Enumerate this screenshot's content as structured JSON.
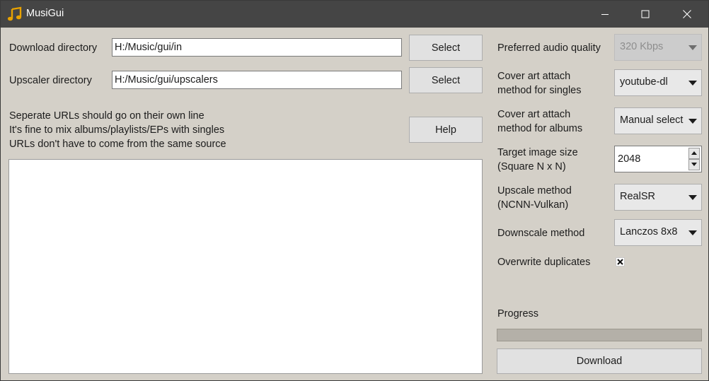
{
  "window": {
    "title": "MusiGui",
    "icon": "music-note-icon",
    "controls": [
      "minimize-icon",
      "maximize-icon",
      "close-icon"
    ]
  },
  "directories": {
    "download_label": "Download directory",
    "download_value": "H:/Music/gui/in",
    "download_button": "Select",
    "upscaler_label": "Upscaler directory",
    "upscaler_value": "H:/Music/gui/upscalers",
    "upscaler_button": "Select"
  },
  "instructions": {
    "line1": "Seperate URLs should go on their own line",
    "line2": "It's fine to mix albums/playlists/EPs with singles",
    "line3": "URLs don't have to come from the same source",
    "help_button": "Help"
  },
  "url_input": {
    "value": ""
  },
  "settings": {
    "audio_quality": {
      "label": "Preferred audio quality",
      "value": "320 Kbps",
      "disabled": true
    },
    "cover_singles": {
      "label_line1": "Cover art attach",
      "label_line2": "method for singles",
      "value": "youtube-dl"
    },
    "cover_albums": {
      "label_line1": "Cover art attach",
      "label_line2": "method for albums",
      "value": "Manual select"
    },
    "image_size": {
      "label_line1": "Target image size",
      "label_line2": "(Square N x N)",
      "value": "2048"
    },
    "upscale_method": {
      "label_line1": "Upscale method",
      "label_line2": "(NCNN-Vulkan)",
      "value": "RealSR"
    },
    "downscale_method": {
      "label": "Downscale method",
      "value": "Lanczos 8x8"
    },
    "overwrite": {
      "label": "Overwrite duplicates",
      "checked": true
    }
  },
  "progress": {
    "label": "Progress",
    "value": 0
  },
  "download_button": "Download",
  "colors": {
    "titlebar": "#454545",
    "window_bg": "#d4d0c8",
    "progress_track": "#b4b0a8",
    "icon_accent": "#e8a200"
  }
}
